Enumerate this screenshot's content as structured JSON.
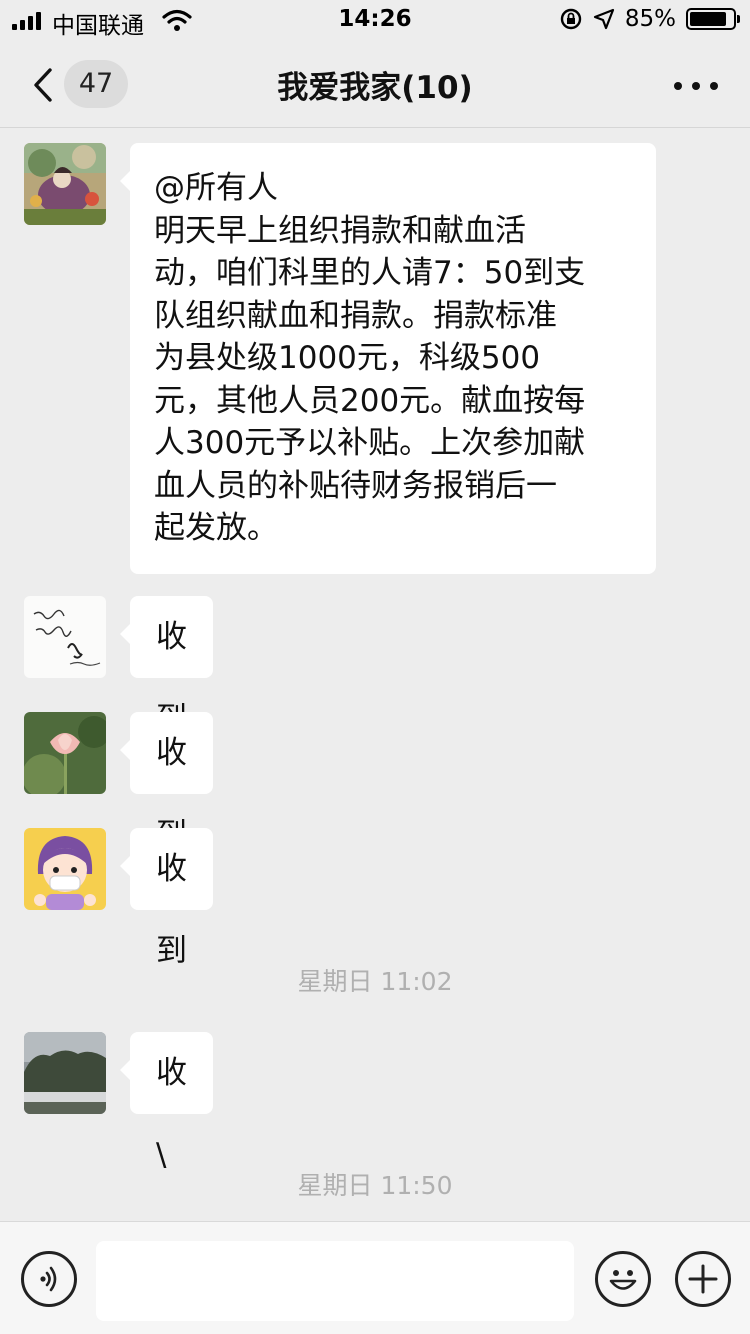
{
  "status_bar": {
    "carrier": "中国联通",
    "time": "14:26",
    "battery_text": "85%",
    "battery_level": 0.85
  },
  "header": {
    "unread_count": "47",
    "title": "我爱我家(10)"
  },
  "messages": [
    {
      "avatar_icon": "painting-avatar",
      "lines": [
        "@所有人",
        "明天早上组织捐款和献血活",
        "动，咱们科里的人请7：50到支",
        "队组织献血和捐款。捐款标准",
        "为县处级1000元，科级500",
        "元，其他人员200元。献血按每",
        "人300元予以补贴。上次参加献",
        "血人员的补贴待财务报销后一",
        "起发放。"
      ]
    },
    {
      "avatar_icon": "calligraphy-avatar",
      "text": "收到"
    },
    {
      "avatar_icon": "lotus-avatar",
      "text": "收到"
    },
    {
      "avatar_icon": "cartoon-girl-avatar",
      "text": "收到"
    },
    {
      "avatar_icon": "landscape-avatar",
      "text": "收\\"
    }
  ],
  "timestamps": [
    "星期日 11:02",
    "星期日 11:50"
  ],
  "input_bar": {
    "voice_icon": "voice-icon",
    "emoji_icon": "emoji-icon",
    "plus_icon": "plus-icon"
  },
  "colors": {
    "background": "#ededed",
    "bubble": "#ffffff",
    "timestamp": "#b0b0b0"
  }
}
